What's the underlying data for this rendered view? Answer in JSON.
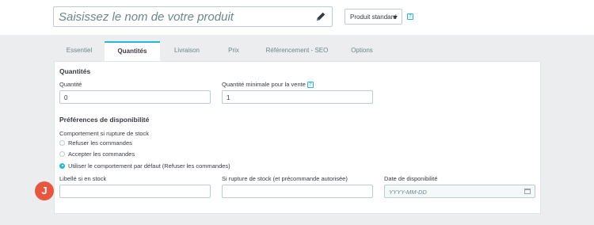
{
  "header": {
    "product_name_placeholder": "Saisissez le nom de votre produit",
    "product_type": "Produit standard",
    "help_glyph": "?"
  },
  "tabs": [
    {
      "label": "Essentiel",
      "active": false
    },
    {
      "label": "Quantités",
      "active": true
    },
    {
      "label": "Livraison",
      "active": false
    },
    {
      "label": "Prix",
      "active": false
    },
    {
      "label": "Référencement - SEO",
      "active": false
    },
    {
      "label": "Options",
      "active": false
    }
  ],
  "quantities": {
    "title": "Quantités",
    "quantity_label": "Quantité",
    "quantity_value": "0",
    "min_quantity_label": "Quantité minimale pour la vente",
    "min_quantity_value": "1"
  },
  "availability": {
    "title": "Préférences de disponibilité",
    "behavior_label": "Comportement si rupture de stock",
    "options": [
      {
        "label": "Refuser les commandes",
        "checked": false
      },
      {
        "label": "Accepter les commandes",
        "checked": false
      },
      {
        "label": "Utiliser le comportement par défaut (Refuser les commandes)",
        "checked": true
      }
    ],
    "in_stock_label": "Libellé si en stock",
    "in_stock_value": "",
    "backorder_label": "Si rupture de stock (et précommande autorisée)",
    "backorder_value": "",
    "date_label": "Date de disponibilité",
    "date_placeholder": "YYYY-MM-DD"
  },
  "marker": {
    "letter": "J"
  },
  "colors": {
    "accent": "#25b9d7",
    "marker": "#e8563f",
    "background": "#ebedef"
  },
  "icons": {
    "pencil": "pencil-icon",
    "calendar": "calendar-icon",
    "help": "help-icon"
  }
}
